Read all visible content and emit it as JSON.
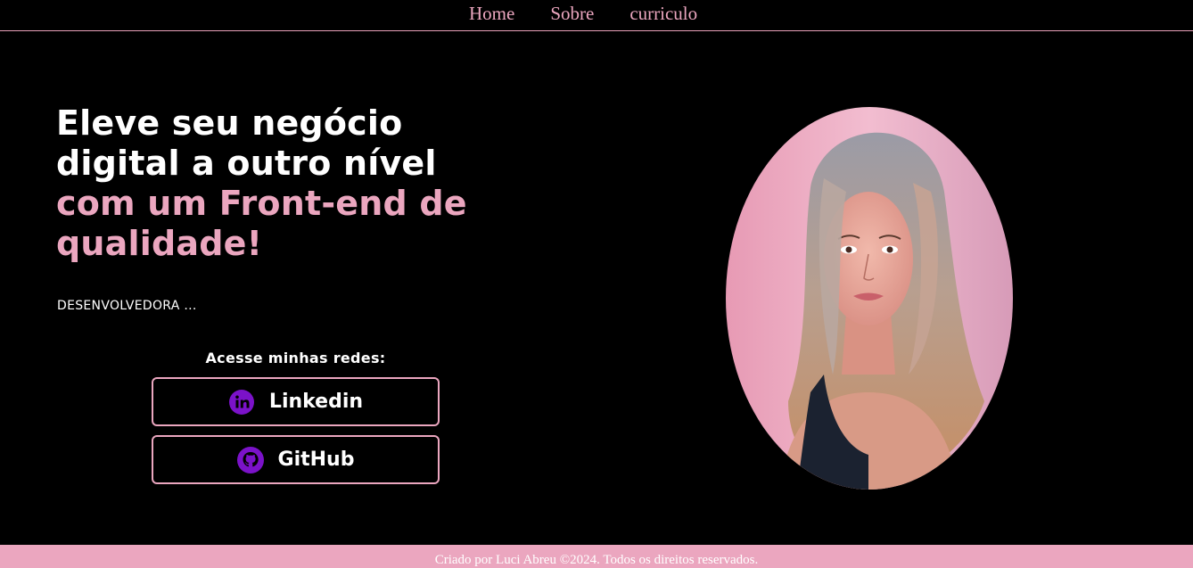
{
  "nav": {
    "items": [
      {
        "label": "Home"
      },
      {
        "label": "Sobre"
      },
      {
        "label": "curriculo"
      }
    ]
  },
  "hero": {
    "title_line1": "Eleve seu negócio",
    "title_line2": "digital a outro nível",
    "title_accent_line1": "com um Front-end de",
    "title_accent_line2": "qualidade!",
    "subtitle": "DESENVOLVEDORA ..."
  },
  "social": {
    "heading": "Acesse minhas redes:",
    "links": [
      {
        "label": "Linkedin",
        "icon": "linkedin-icon"
      },
      {
        "label": "GitHub",
        "icon": "github-icon"
      }
    ]
  },
  "portrait": {
    "icon": "profile-photo"
  },
  "footer": {
    "text": "Criado por Luci Abreu ©2024. Todos os direitos reservados."
  },
  "colors": {
    "background": "#000000",
    "accent": "#eba6bf",
    "icon_purple": "#7b12c9",
    "text": "#ffffff"
  }
}
